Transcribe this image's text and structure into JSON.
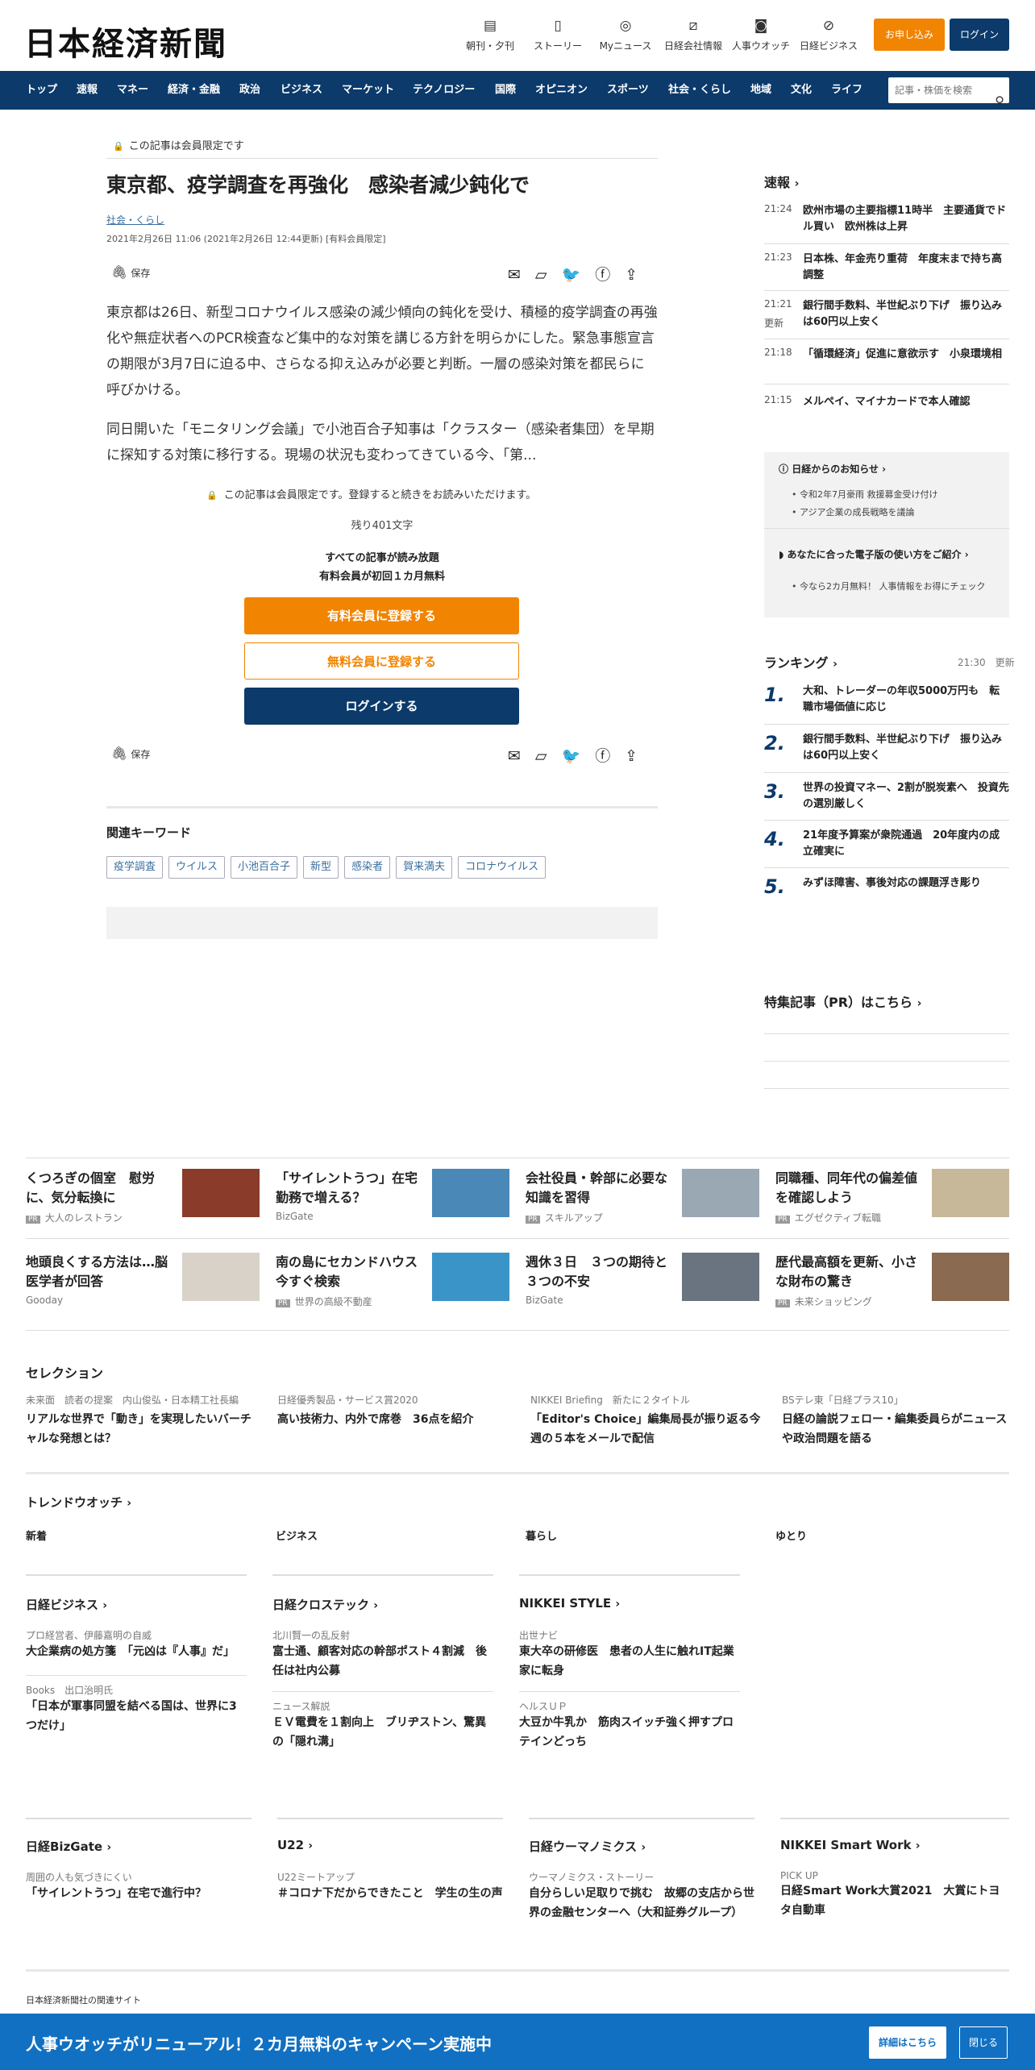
{
  "header": {
    "logo": "日本経済新聞",
    "icons": [
      {
        "label": "朝刊・夕刊",
        "icon": "newspaper-icon"
      },
      {
        "label": "ストーリー",
        "icon": "story-icon"
      },
      {
        "label": "Myニュース",
        "icon": "user-icon"
      },
      {
        "label": "日経会社情報",
        "icon": "chart-icon"
      },
      {
        "label": "人事ウオッチ",
        "icon": "search-icon"
      },
      {
        "label": "日経ビジネス",
        "icon": "compass-icon"
      }
    ],
    "apply": "お申し込み",
    "login": "ログイン"
  },
  "nav": {
    "items": [
      "トップ",
      "速報",
      "マネー",
      "経済・金融",
      "政治",
      "ビジネス",
      "マーケット",
      "テクノロジー",
      "国際",
      "オピニオン",
      "スポーツ",
      "社会・くらし",
      "地域",
      "文化",
      "ライフ"
    ],
    "search_placeholder": "記事・株価を検索"
  },
  "article": {
    "members_only": "この記事は会員限定です",
    "title": "東京都、疫学調査を再強化　感染者減少鈍化で",
    "category": "社会・くらし",
    "date": "2021年2月26日 11:06 (2021年2月26日 12:44更新) [有料会員限定]",
    "save": "保存",
    "p1": "東京都は26日、新型コロナウイルス感染の減少傾向の鈍化を受け、積極的疫学調査の再強化や無症状者へのPCR検査など集中的な対策を講じる方針を明らかにした。緊急事態宣言の期限が3月7日に迫る中、さらなる抑え込みが必要と判断。一層の感染対策を都民らに呼びかける。",
    "p2": "同日開いた「モニタリング会議」で小池百合子知事は「クラスター（感染者集団）を早期に探知する対策に移行する。現場の状況も変わってきている今、「第...",
    "lock_notice": "この記事は会員限定です。登録すると続きをお読みいただけます。",
    "remaining": "残り401文字",
    "promo1": "すべての記事が読み放題",
    "promo2": "有料会員が初回１カ月無料",
    "btn_paid": "有料会員に登録する",
    "btn_free": "無料会員に登録する",
    "btn_login": "ログインする",
    "keywords_title": "関連キーワード",
    "keywords": [
      "疫学調査",
      "ウイルス",
      "小池百合子",
      "新型",
      "感染者",
      "賀来満夫",
      "コロナウイルス"
    ]
  },
  "sidebar": {
    "breaking_title": "速報",
    "breaking": [
      {
        "time": "21:24",
        "headline": "欧州市場の主要指標11時半　主要通貨でドル買い　欧州株は上昇"
      },
      {
        "time": "21:23",
        "headline": "日本株、年金売り重荷　年度末まで持ち高調整"
      },
      {
        "time": "21:21",
        "updated": "更新",
        "headline": "銀行間手数料、半世紀ぶり下げ　振り込みは60円以上安く"
      },
      {
        "time": "21:18",
        "headline": "「循環経済」促進に意欲示す　小泉環境相"
      },
      {
        "time": "21:15",
        "headline": "メルペイ、マイナカードで本人確認"
      }
    ],
    "notice_title": "日経からのお知らせ",
    "notices": [
      "令和2年7月豪雨 救援募金受け付け",
      "アジア企業の成長戦略を議論"
    ],
    "guide_title": "あなたに合った電子版の使い方をご紹介",
    "guides": [
      "今なら2カ月無料！ 人事情報をお得にチェック"
    ],
    "ranking_title": "ランキング",
    "ranking_time": "21:30",
    "ranking_updated": "更新",
    "ranking": [
      {
        "n": "1.",
        "headline": "大和、トレーダーの年収5000万円も　転職市場価値に応じ"
      },
      {
        "n": "2.",
        "headline": "銀行間手数料、半世紀ぶり下げ　振り込みは60円以上安く"
      },
      {
        "n": "3.",
        "headline": "世界の投資マネー、2割が脱炭素へ　投資先の選別厳しく"
      },
      {
        "n": "4.",
        "headline": "21年度予算案が衆院通過　20年度内の成立確実に"
      },
      {
        "n": "5.",
        "headline": "みずほ障害、事後対応の課題浮き彫り"
      }
    ],
    "special_title": "特集記事（PR）はこちら"
  },
  "ads": [
    {
      "headline": "くつろぎの個室　慰労に、気分転換に",
      "source": "大人のレストラン",
      "pr": "PR",
      "img_color": "#8a3b2a"
    },
    {
      "headline": "「サイレントうつ」在宅勤務で増える？",
      "source": "BizGate",
      "pr": "",
      "img_color": "#4a88b8"
    },
    {
      "headline": "会社役員・幹部に必要な知識を習得",
      "source": "スキルアップ",
      "pr": "PR",
      "img_color": "#9aa8b4"
    },
    {
      "headline": "同職種、同年代の偏差値を確認しよう",
      "source": "エグゼクティブ転職",
      "pr": "PR",
      "img_color": "#c8b89a"
    },
    {
      "headline": "地頭良くする方法は…脳医学者が回答",
      "source": "Gooday",
      "pr": "",
      "img_color": "#d8d2c8"
    },
    {
      "headline": "南の島にセカンドハウス　今すぐ検索",
      "source": "世界の高級不動産",
      "pr": "PR",
      "img_color": "#3a94c8"
    },
    {
      "headline": "週休３日　３つの期待と３つの不安",
      "source": "BizGate",
      "pr": "",
      "img_color": "#6a7480"
    },
    {
      "headline": "歴代最高額を更新、小さな財布の驚き",
      "source": "未来ショッピング",
      "pr": "PR",
      "img_color": "#8a6a50"
    }
  ],
  "selection": {
    "title": "セレクション",
    "items": [
      {
        "label": "未来面　読者の提案　内山俊弘・日本精工社長編",
        "headline": "リアルな世界で「動き」を実現したいバーチャルな発想とは？"
      },
      {
        "label": "日経優秀製品・サービス賞2020",
        "headline": "高い技術力、内外で席巻　36点を紹介"
      },
      {
        "label": "NIKKEI Briefing　新たに２タイトル",
        "headline": "「Editor's Choice」編集局長が振り返る今週の５本をメールで配信"
      },
      {
        "label": "BSテレ東「日経プラス10」",
        "headline": "日経の論説フェロー・編集委員らがニュースや政治問題を語る"
      }
    ]
  },
  "trend": {
    "title": "トレンドウオッチ",
    "tabs": [
      "新着",
      "ビジネス",
      "暮らし",
      "ゆとり"
    ]
  },
  "media": {
    "row1": [
      {
        "title": "日経ビジネス",
        "items": [
          {
            "label": "プロ経営者、伊藤嘉明の自威",
            "headline": "大企業病の処方箋　「元凶は『人事』だ」"
          },
          {
            "label": "Books　出口治明氏",
            "headline": "「日本が軍事同盟を結べる国は、世界に3つだけ」"
          }
        ]
      },
      {
        "title": "日経クロステック",
        "items": [
          {
            "label": "北川賢一の乱反射",
            "headline": "富士通、顧客対応の幹部ポスト４割減　後任は社内公募"
          },
          {
            "label": "ニュース解説",
            "headline": "ＥＶ電費を１割向上　ブリヂストン、驚異の「隠れ溝」"
          }
        ]
      },
      {
        "title": "NIKKEI STYLE",
        "items": [
          {
            "label": "出世ナビ",
            "headline": "東大卒の研修医　患者の人生に触れIT起業家に転身"
          },
          {
            "label": "ヘルスＵＰ",
            "headline": "大豆か牛乳か　筋肉スイッチ強く押すプロテインどっち"
          }
        ]
      }
    ],
    "row2": [
      {
        "title": "日経BizGate",
        "items": [
          {
            "label": "周囲の人も気づきにくい",
            "headline": "「サイレントうつ」在宅で進行中？"
          }
        ]
      },
      {
        "title": "U22",
        "items": [
          {
            "label": "U22ミートアップ",
            "headline": "＃コロナ下だからできたこと　学生の生の声"
          }
        ]
      },
      {
        "title": "日経ウーマノミクス",
        "items": [
          {
            "label": "ウーマノミクス・ストーリー",
            "headline": "自分らしい足取りで挑む　故郷の支店から世界の金融センターへ（大和証券グループ）"
          }
        ]
      },
      {
        "title": "NIKKEI Smart Work",
        "items": [
          {
            "label": "PICK UP",
            "headline": "日経Smart Work大賞2021　大賞にトヨタ自動車"
          }
        ]
      }
    ]
  },
  "footer": {
    "related_sites": "日本経済新聞社の関連サイト",
    "banner_text": "人事ウオッチがリニューアル！２カ月無料のキャンペーン実施中",
    "banner_details": "詳細はこちら",
    "banner_close": "閉じる",
    "banner_color": "#1170c2"
  }
}
